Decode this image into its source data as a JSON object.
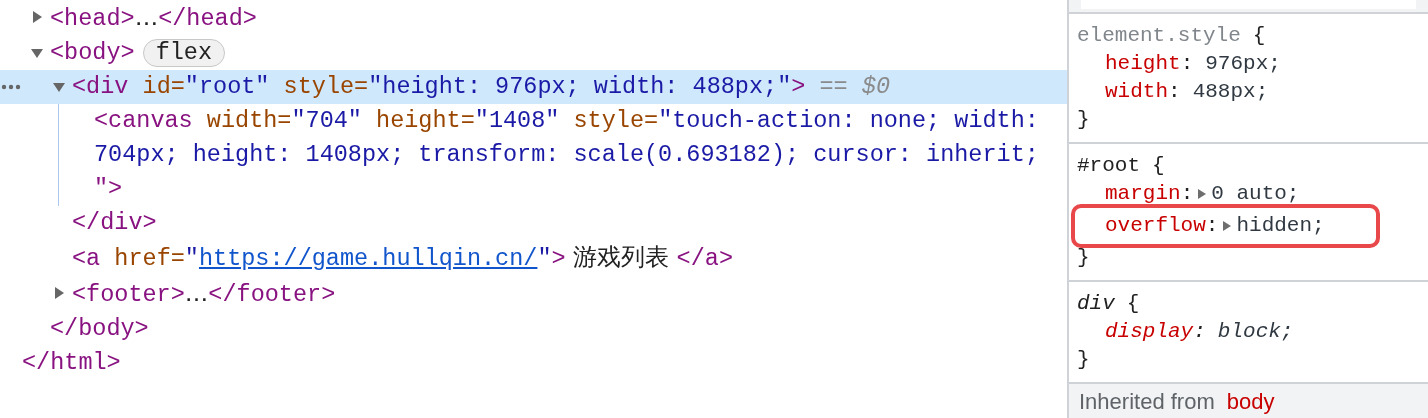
{
  "dom_tree": {
    "nodes": [
      {
        "expanded": false,
        "selected": false,
        "open": [
          {
            "kind": "tag",
            "text": "<head>"
          },
          {
            "kind": "text",
            "text": "…"
          },
          {
            "kind": "tag",
            "text": "</head>"
          }
        ]
      },
      {
        "expanded": true,
        "selected": false,
        "open": [
          {
            "kind": "tag",
            "text": "<body>"
          }
        ],
        "badge": "flex",
        "children": [
          {
            "expanded": true,
            "selected": true,
            "open": [
              {
                "kind": "tag",
                "text": "<div"
              },
              {
                "kind": "attr",
                "text": " id="
              },
              {
                "kind": "value",
                "text": "\"root\""
              },
              {
                "kind": "attr",
                "text": " style="
              },
              {
                "kind": "value",
                "text": "\"height: 976px; width: 488px;\""
              },
              {
                "kind": "tag",
                "text": ">"
              },
              {
                "kind": "dim",
                "text": " == "
              },
              {
                "kind": "var",
                "text": "$0"
              }
            ],
            "children": [
              {
                "selected": false,
                "open": [
                  {
                    "kind": "tag",
                    "text": "<canvas"
                  },
                  {
                    "kind": "attr",
                    "text": " width="
                  },
                  {
                    "kind": "value",
                    "text": "\"704\""
                  },
                  {
                    "kind": "attr",
                    "text": " height="
                  },
                  {
                    "kind": "value",
                    "text": "\"1408\""
                  },
                  {
                    "kind": "attr",
                    "text": " style="
                  },
                  {
                    "kind": "value",
                    "text": "\"touch-action: none; width: 704px; height: 1408px; transform: scale(0.693182); cursor: inherit;"
                  },
                  {
                    "kind": "tag",
                    "text": " \">"
                  }
                ]
              }
            ],
            "close": [
              {
                "kind": "tag",
                "text": "</div>"
              }
            ]
          },
          {
            "selected": false,
            "open": [
              {
                "kind": "tag",
                "text": "<a"
              },
              {
                "kind": "attr",
                "text": " href="
              },
              {
                "kind": "value",
                "text": "\""
              },
              {
                "kind": "link",
                "text": "https://game.hullqin.cn/"
              },
              {
                "kind": "value",
                "text": "\""
              },
              {
                "kind": "tag",
                "text": ">"
              },
              {
                "kind": "text",
                "text": " 游戏列表 "
              },
              {
                "kind": "tag",
                "text": "</a>"
              }
            ]
          },
          {
            "expanded": false,
            "selected": false,
            "open": [
              {
                "kind": "tag",
                "text": "<footer>"
              },
              {
                "kind": "text",
                "text": "…"
              },
              {
                "kind": "tag",
                "text": "</footer>"
              }
            ]
          }
        ],
        "close": [
          {
            "kind": "tag",
            "text": "</body>"
          }
        ]
      }
    ],
    "end": [
      {
        "kind": "tag",
        "text": "</html>"
      }
    ]
  },
  "styles": {
    "rules": [
      {
        "selector": "element.style",
        "kind": "inline",
        "open_brace": "{",
        "close_brace": "}",
        "declarations": [
          {
            "property": "height",
            "sep": ":",
            "value": "976px;",
            "expandable": false,
            "highlighted": false
          },
          {
            "property": "width",
            "sep": ":",
            "value": "488px;",
            "expandable": false,
            "highlighted": false
          }
        ]
      },
      {
        "selector": "#root",
        "kind": "author",
        "open_brace": "{",
        "close_brace": "}",
        "declarations": [
          {
            "property": "margin",
            "sep": ":",
            "value": "0 auto;",
            "expandable": true,
            "highlighted": false
          },
          {
            "property": "overflow",
            "sep": ":",
            "value": "hidden;",
            "expandable": true,
            "highlighted": true
          }
        ]
      },
      {
        "selector": "div",
        "kind": "user_agent",
        "open_brace": "{",
        "close_brace": "}",
        "declarations": [
          {
            "property": "display",
            "sep": ":",
            "value": "block;",
            "expandable": false,
            "highlighted": false
          }
        ]
      }
    ],
    "inherited_label": "Inherited from",
    "inherited_source": "body"
  }
}
